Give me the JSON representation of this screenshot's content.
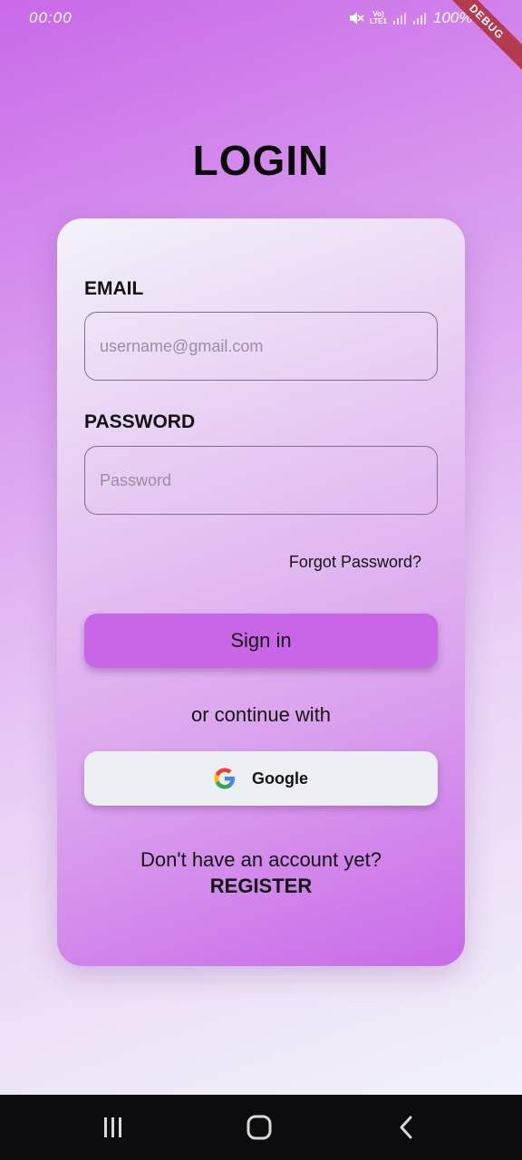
{
  "status_bar": {
    "time": "00:00",
    "volte_line1": "Vo)",
    "volte_line2": "LTE1",
    "battery": "100%"
  },
  "debug_banner": "DEBUG",
  "title": "LOGIN",
  "email": {
    "label": "EMAIL",
    "placeholder": "username@gmail.com",
    "value": ""
  },
  "password": {
    "label": "PASSWORD",
    "placeholder": "Password",
    "value": ""
  },
  "forgot_password": "Forgot Password?",
  "signin_label": "Sign in",
  "divider_text": "or continue with",
  "google": {
    "label": "Google",
    "icon": "google-logo-icon"
  },
  "register_prompt": "Don't have an account yet?",
  "register_label": "REGISTER",
  "nav": {
    "recent_icon": "recent-apps-icon",
    "home_icon": "home-icon",
    "back_icon": "back-icon"
  },
  "colors": {
    "accent": "#c966e8",
    "nav_bg": "#0c0c0e",
    "debug": "#b43a50"
  }
}
